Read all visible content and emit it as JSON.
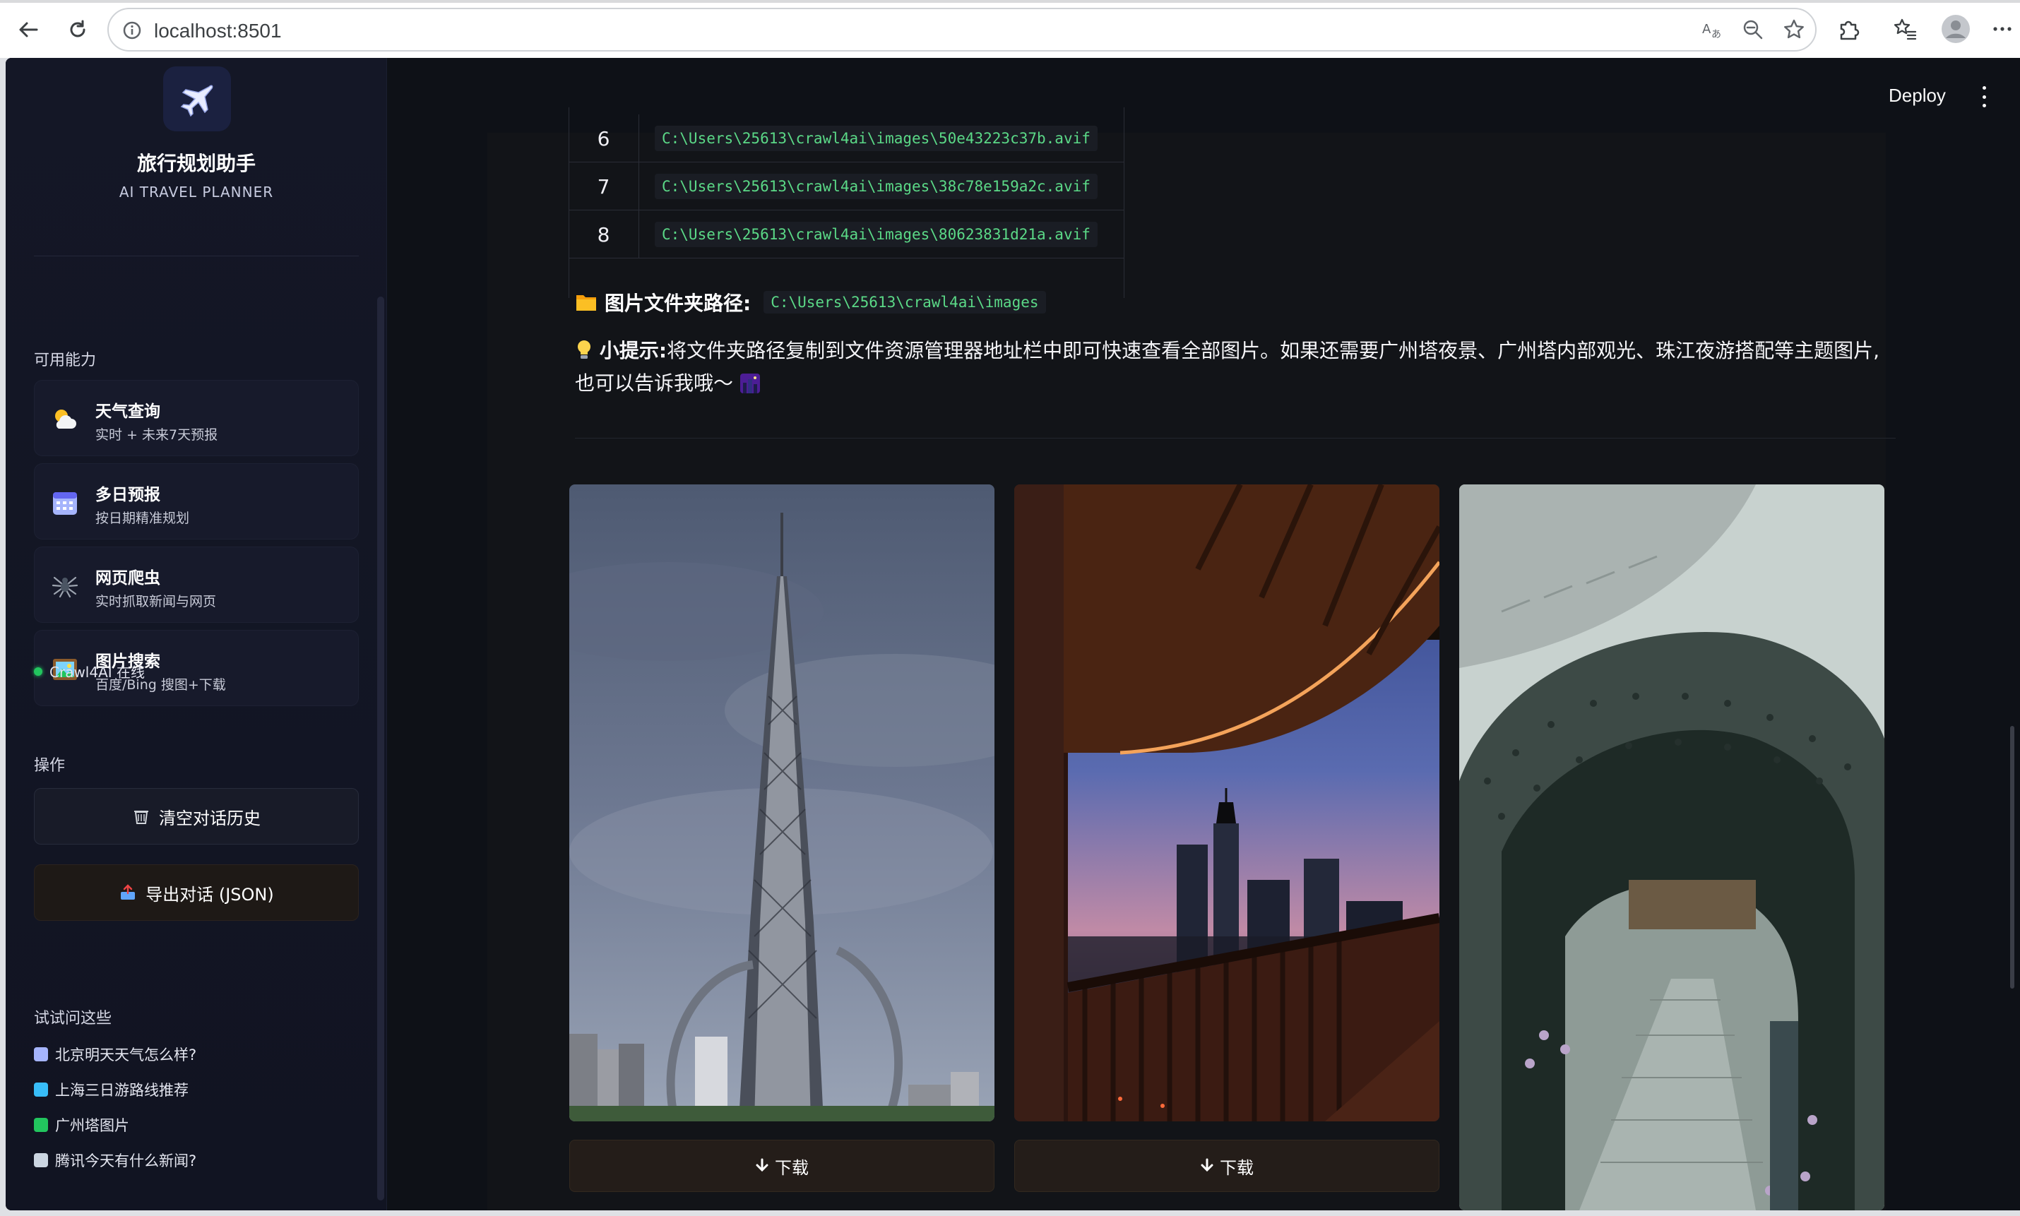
{
  "browser": {
    "url": "localhost:8501"
  },
  "sidebar": {
    "title": "旅行规划助手",
    "subtitle": "AI TRAVEL PLANNER",
    "capabilities_label": "可用能力",
    "capabilities": [
      {
        "title": "天气查询",
        "desc": "实时 + 未来7天预报",
        "icon": "weather-icon"
      },
      {
        "title": "多日预报",
        "desc": "按日期精准规划",
        "icon": "calendar-icon"
      },
      {
        "title": "网页爬虫",
        "desc": "实时抓取新闻与网页",
        "icon": "spider-icon"
      },
      {
        "title": "图片搜索",
        "desc": "百度/Bing 搜图+下载",
        "icon": "picture-icon"
      }
    ],
    "status": "Crawl4AI 在线",
    "actions_label": "操作",
    "clear_button": "清空对话历史",
    "export_button": "导出对话 (JSON)",
    "suggestions_label": "试试问这些",
    "suggestions": [
      "北京明天天气怎么样?",
      "上海三日游路线推荐",
      "广州塔图片",
      "腾讯今天有什么新闻?"
    ]
  },
  "header": {
    "deploy_label": "Deploy"
  },
  "main": {
    "table_rows": [
      {
        "num": "6",
        "path": "C:\\Users\\25613\\crawl4ai\\images\\50e43223c37b.avif"
      },
      {
        "num": "7",
        "path": "C:\\Users\\25613\\crawl4ai\\images\\38c78e159a2c.avif"
      },
      {
        "num": "8",
        "path": "C:\\Users\\25613\\crawl4ai\\images\\80623831d21a.avif"
      }
    ],
    "folder_label": "图片文件夹路径:",
    "folder_path": "C:\\Users\\25613\\crawl4ai\\images",
    "tip_label": "小提示:",
    "tip_text": "将文件夹路径复制到文件资源管理器地址栏中即可快速查看全部图片。如果还需要广州塔夜景、广州塔内部观光、珠江夜游搭配等主题图片,也可以告诉我哦～",
    "download_label": "下载"
  },
  "colors": {
    "app_bg": "#0e1117",
    "sidebar_bg": "#141726",
    "code_green": "#5bd987",
    "status_green": "#22c55e"
  }
}
